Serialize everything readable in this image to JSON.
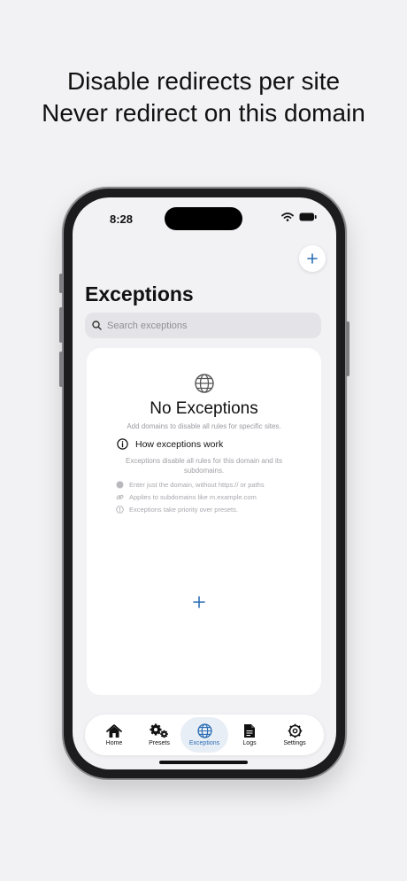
{
  "headline": {
    "line1": "Disable redirects per site",
    "line2": "Never redirect on this domain"
  },
  "status_bar": {
    "time": "8:28",
    "icons": [
      "wifi-icon",
      "battery-icon"
    ]
  },
  "header": {
    "title": "Exceptions",
    "add_icon": "plus-icon"
  },
  "search": {
    "placeholder": "Search exceptions",
    "value": ""
  },
  "empty_state": {
    "icon": "globe-icon",
    "title": "No Exceptions",
    "subtitle": "Add domains to disable all rules for specific sites.",
    "info_title": "How exceptions work",
    "info_description": "Exceptions disable all rules for this domain and its subdomains.",
    "tips": [
      {
        "icon": "globe-icon",
        "text": "Enter just the domain, without https:// or paths"
      },
      {
        "icon": "link-icon",
        "text": "Applies to subdomains like m.example.com"
      },
      {
        "icon": "priority-icon",
        "text": "Exceptions take priority over presets."
      }
    ],
    "add_icon": "plus-icon"
  },
  "tabs": [
    {
      "label": "Home",
      "icon": "house-icon",
      "active": false
    },
    {
      "label": "Presets",
      "icon": "gears-icon",
      "active": false
    },
    {
      "label": "Exceptions",
      "icon": "globe-icon",
      "active": true
    },
    {
      "label": "Logs",
      "icon": "document-icon",
      "active": false
    },
    {
      "label": "Settings",
      "icon": "gear-icon",
      "active": false
    }
  ],
  "colors": {
    "accent": "#2d6eb4",
    "background": "#f2f2f4",
    "card": "#ffffff"
  }
}
